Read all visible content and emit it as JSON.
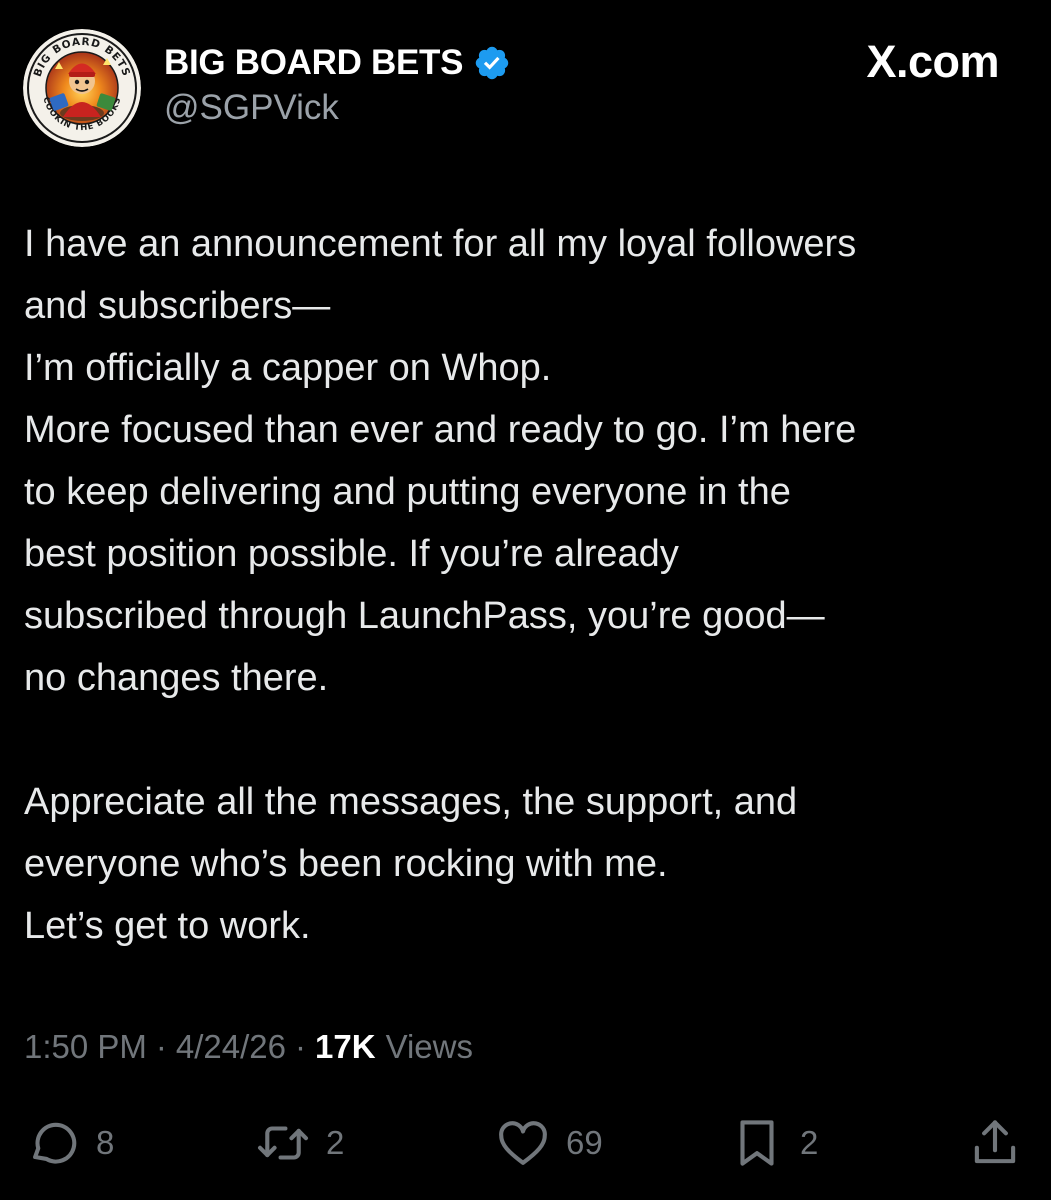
{
  "author": {
    "display_name": "BIG BOARD BETS",
    "handle": "@SGPVick",
    "verified": true,
    "avatar": {
      "ring_text_top": "BIG BOARD BETS",
      "ring_text_bottom": "COOKIN THE BOOKS"
    }
  },
  "brand": "X.com",
  "post": {
    "lines": [
      "I have an announcement for all my loyal followers",
      "and subscribers—",
      "I’m officially a capper on Whop.",
      "More focused than ever and ready to go. I’m here",
      "to keep delivering and putting everyone in the",
      "best position possible. If you’re already",
      "subscribed through LaunchPass, you’re good—",
      "no changes there.",
      "",
      "Appreciate all the messages, the support, and",
      "everyone who’s been rocking with me.",
      "Let’s get to work."
    ]
  },
  "meta": {
    "time": "1:50 PM",
    "date": "4/24/26",
    "separator": "·",
    "views_count": "17K",
    "views_label": "Views"
  },
  "actions": {
    "replies": "8",
    "reposts": "2",
    "likes": "69",
    "bookmarks": "2"
  },
  "colors": {
    "background": "#000000",
    "text": "#e7e9ea",
    "secondary": "#71767b",
    "verified_badge": "#1d9bf0"
  }
}
